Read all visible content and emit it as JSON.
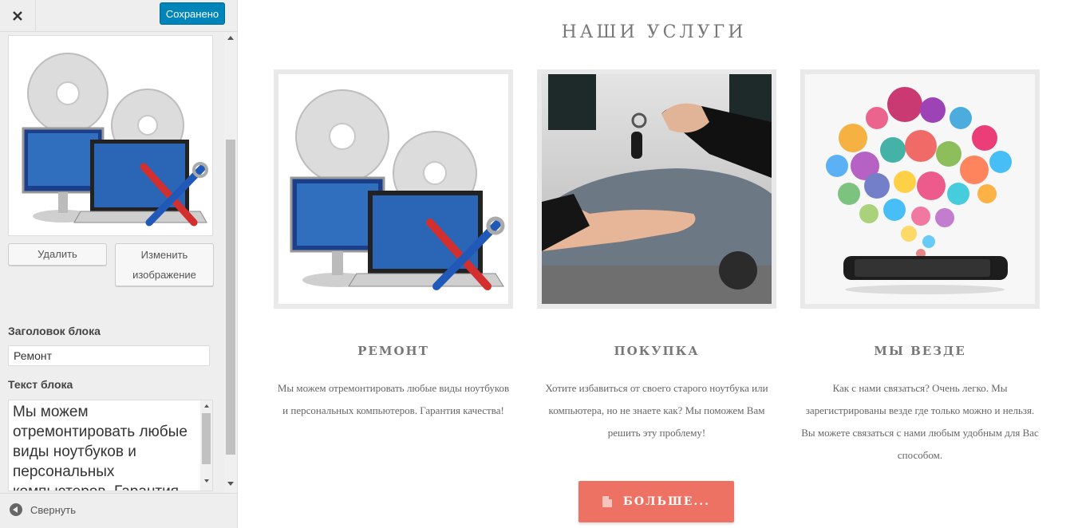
{
  "sidebar": {
    "close_icon": "close-icon",
    "save_label": "Сохранено",
    "delete_label": "Удалить",
    "change_label_line1": "Изменить",
    "change_label_line2": "изображение",
    "title_field_label": "Заголовок блока",
    "title_field_value": "Ремонт",
    "text_field_label": "Текст блока",
    "text_field_value": "Мы можем отремонтировать любые виды ноутбуков и персональных компьютеров. Гарантия качества!",
    "collapse_label": "Свернуть"
  },
  "main": {
    "section_title": "НАШИ УСЛУГИ",
    "cards": [
      {
        "heading": "РЕМОНТ",
        "desc": "Мы можем отремонтировать любые виды ноутбуков и персональных компьютеров. Гарантия качества!",
        "image": "computer-repair-image"
      },
      {
        "heading": "ПОКУПКА",
        "desc": "Хотите избавиться от своего старого ноутбука или компьютера, но не знаете как? Мы поможем Вам решить эту проблему!",
        "image": "car-keys-handover-image"
      },
      {
        "heading": "МЫ ВЕЗДЕ",
        "desc": "Как с нами связаться? Очень легко. Мы зарегистрированы везде где только можно и нельзя. Вы можете связаться с нами любым удобным для Вас способом.",
        "image": "social-icons-phone-image"
      }
    ],
    "more_button_label": "БОЛЬШЕ..."
  },
  "colors": {
    "save_button": "#0085ba",
    "more_button": "#ee7263",
    "heading_gray": "#777777"
  }
}
